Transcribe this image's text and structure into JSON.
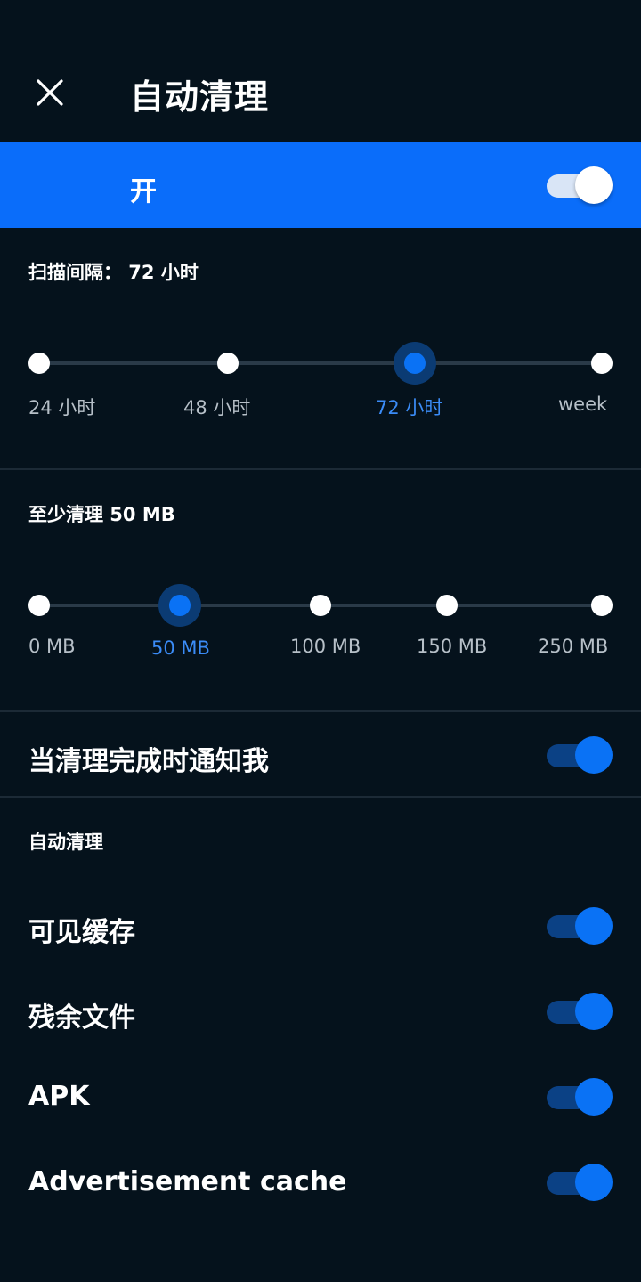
{
  "header": {
    "title": "自动清理"
  },
  "master": {
    "label": "开",
    "enabled": true
  },
  "scan": {
    "label": "扫描间隔： 72 小时",
    "options": [
      "24 小时",
      "48 小时",
      "72 小时",
      "week"
    ],
    "selected_index": 2
  },
  "min_clean": {
    "label": "至少清理 50 MB",
    "options": [
      "0 MB",
      "50 MB",
      "100 MB",
      "150 MB",
      "250 MB"
    ],
    "selected_index": 1
  },
  "notify": {
    "label": "当清理完成时通知我",
    "enabled": true
  },
  "auto_clean": {
    "section_label": "自动清理",
    "items": [
      {
        "label": "可见缓存",
        "enabled": true
      },
      {
        "label": "残余文件",
        "enabled": true
      },
      {
        "label": "APK",
        "enabled": true
      },
      {
        "label": "Advertisement cache",
        "enabled": true
      }
    ]
  },
  "colors": {
    "background": "#05121c",
    "accent": "#0a6dfa",
    "toggle_thumb_on": "#0a72f5",
    "toggle_track_on": "#0b4185",
    "inactive_label": "#b7c0c8",
    "active_label": "#3b8cf7"
  },
  "icons": {
    "close": "close-icon"
  }
}
